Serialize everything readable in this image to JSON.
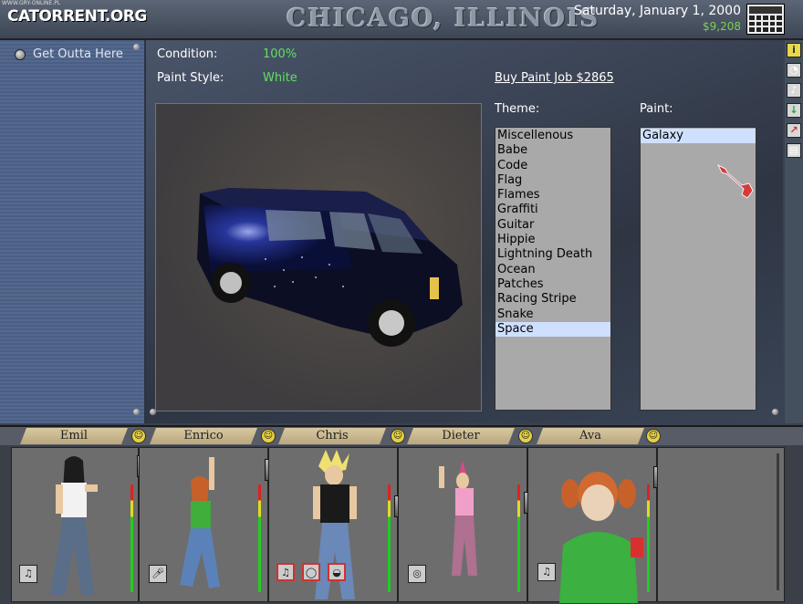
{
  "watermark": {
    "small": "WWW.GRY-ONLINE.PL",
    "logo": "CATORRENT.ORG"
  },
  "header": {
    "city": "CHICAGO, ILLINOIS",
    "date": "Saturday, January 1, 2000",
    "money": "$9,208"
  },
  "sidebar": {
    "items": [
      {
        "label": "Get Outta Here"
      }
    ]
  },
  "vehicle": {
    "condition_label": "Condition:",
    "condition_value": "100%",
    "paint_style_label": "Paint Style:",
    "paint_style_value": "White",
    "buy_label": "Buy Paint Job $2865"
  },
  "theme": {
    "label": "Theme:",
    "items": [
      "Miscellenous",
      "Babe",
      "Code",
      "Flag",
      "Flames",
      "Graffiti",
      "Guitar",
      "Hippie",
      "Lightning Death",
      "Ocean",
      "Patches",
      "Racing Stripe",
      "Snake",
      "Space"
    ],
    "selected": "Space"
  },
  "paint": {
    "label": "Paint:",
    "items": [
      "Galaxy"
    ],
    "selected": "Galaxy"
  },
  "toolbar": {
    "icons": [
      "info-icon",
      "clock-icon",
      "guitar-icon",
      "down-arrow-icon",
      "chart-icon",
      "map-icon"
    ]
  },
  "band": {
    "members": [
      {
        "name": "Emil",
        "instrument_icons": [
          "guitar-icon"
        ]
      },
      {
        "name": "Enrico",
        "instrument_icons": [
          "microphone-icon"
        ]
      },
      {
        "name": "Chris",
        "instrument_icons": [
          "guitar-icon",
          "tambourine-icon",
          "drum-icon"
        ]
      },
      {
        "name": "Dieter",
        "instrument_icons": [
          "snare-icon"
        ]
      },
      {
        "name": "Ava",
        "instrument_icons": [
          "guitar-icon"
        ]
      }
    ]
  },
  "colors": {
    "money": "#7ad04e",
    "value_green": "#5fe05f",
    "selection": "#cfe0ff",
    "list_bg": "#a9a9a9"
  }
}
